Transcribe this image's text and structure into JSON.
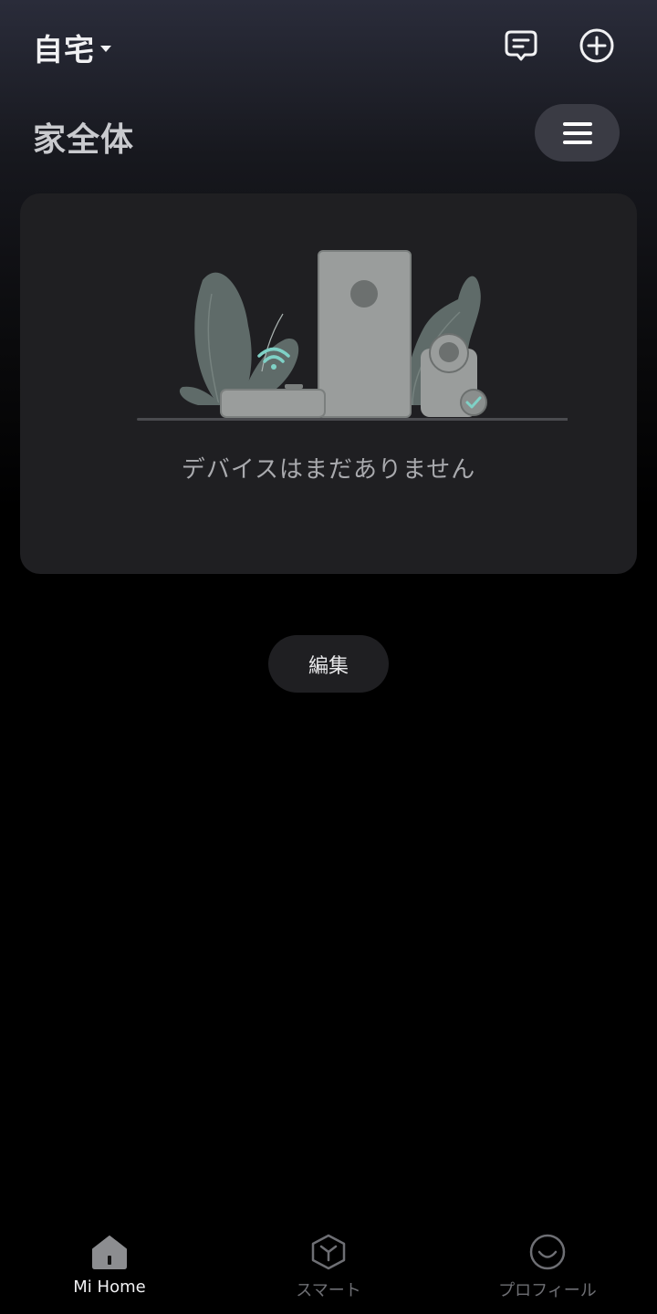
{
  "header": {
    "home_name": "自宅",
    "icons": {
      "message": "message-icon",
      "add": "plus-circle-icon",
      "dropdown": "caret-down-icon"
    }
  },
  "room": {
    "title": "家全体",
    "menu_icon": "hamburger-menu-icon"
  },
  "empty_state": {
    "message": "デバイスはまだありません",
    "illustration": "devices-illustration"
  },
  "edit_button": {
    "label": "編集"
  },
  "bottom_nav": {
    "items": [
      {
        "label": "Mi Home",
        "icon": "home-icon",
        "active": true
      },
      {
        "label": "スマート",
        "icon": "cube-icon",
        "active": false
      },
      {
        "label": "プロフィール",
        "icon": "smile-icon",
        "active": false
      }
    ]
  },
  "colors": {
    "background": "#000000",
    "card": "#1f1f22",
    "accent_wifi": "#7fd1c6",
    "inactive": "#6e6f74"
  }
}
